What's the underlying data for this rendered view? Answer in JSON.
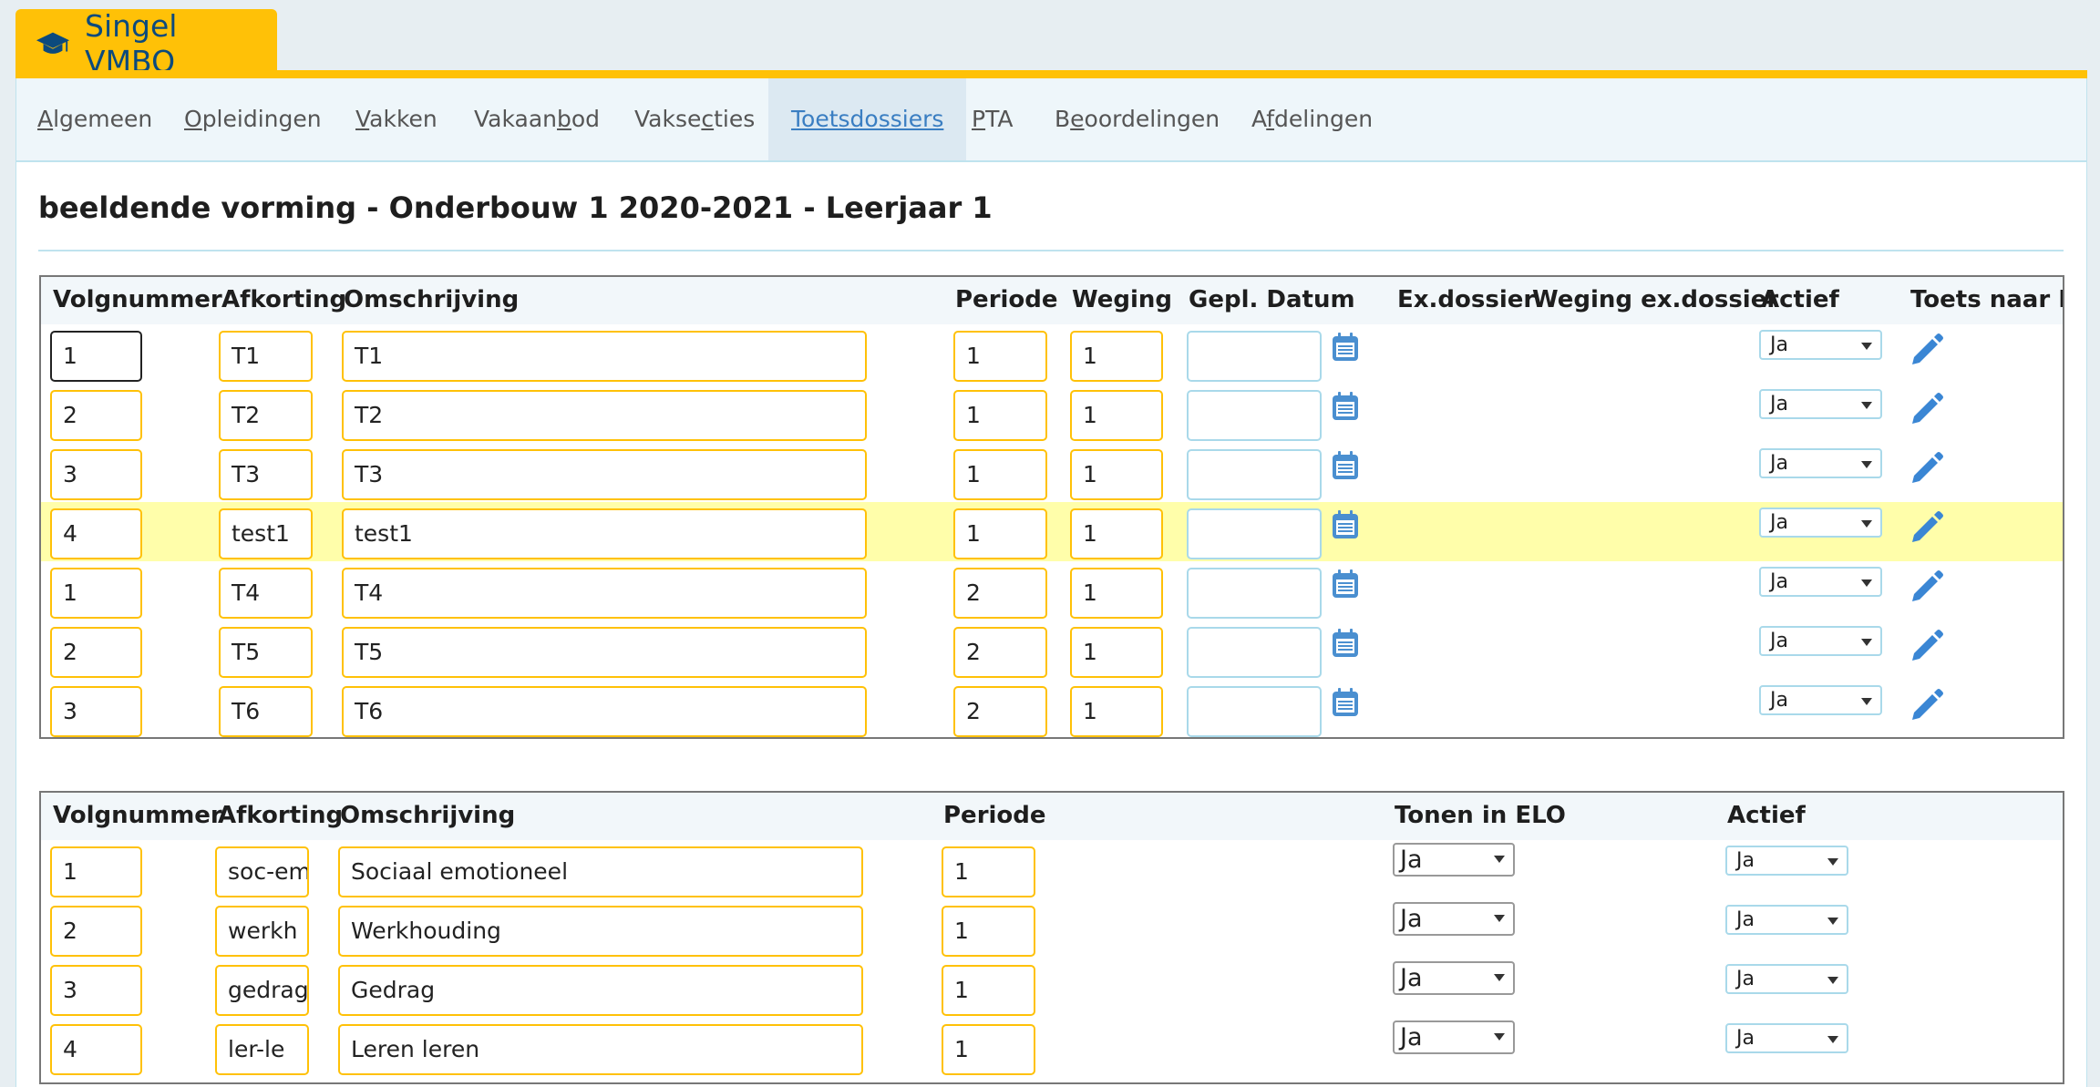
{
  "app": {
    "title": "Singel VMBO",
    "logo_icon": "graduation-cap-icon"
  },
  "colors": {
    "accent": "#ffc107",
    "brand": "#0c4a7d",
    "link_active": "#3a7ec2",
    "highlight_row": "#fffeaa"
  },
  "nav": {
    "items": [
      {
        "pre": "",
        "ul": "A",
        "post": "lgemeen",
        "active": false
      },
      {
        "pre": "",
        "ul": "O",
        "post": "pleidingen",
        "active": false
      },
      {
        "pre": "",
        "ul": "V",
        "post": "akken",
        "active": false
      },
      {
        "pre": "Vakaan",
        "ul": "b",
        "post": "od",
        "active": false
      },
      {
        "pre": "Vakse",
        "ul": "c",
        "post": "ties",
        "active": false
      },
      {
        "pre": "",
        "ul": "T",
        "post": "oetsdossiers",
        "active": true
      },
      {
        "pre": "",
        "ul": "P",
        "post": "TA",
        "active": false
      },
      {
        "pre": "B",
        "ul": "e",
        "post": "oordelingen",
        "active": false
      },
      {
        "pre": "A",
        "ul": "f",
        "post": "delingen",
        "active": false
      }
    ]
  },
  "page": {
    "title": "beeldende vorming - Onderbouw 1 2020-2021 - Leerjaar 1"
  },
  "tests_table": {
    "headers": [
      "Volgnummer",
      "Afkorting",
      "Omschrijving",
      "Periode",
      "Weging",
      "Gepl. Datum",
      "Ex.dossier",
      "Weging ex.dossier",
      "Actief",
      "Toets naar R"
    ],
    "rows": [
      {
        "volgnummer": "1",
        "afkorting": "T1",
        "omschrijving": "T1",
        "periode": "1",
        "weging": "1",
        "datum": "",
        "actief": "Ja"
      },
      {
        "volgnummer": "2",
        "afkorting": "T2",
        "omschrijving": "T2",
        "periode": "1",
        "weging": "1",
        "datum": "",
        "actief": "Ja"
      },
      {
        "volgnummer": "3",
        "afkorting": "T3",
        "omschrijving": "T3",
        "periode": "1",
        "weging": "1",
        "datum": "",
        "actief": "Ja"
      },
      {
        "volgnummer": "4",
        "afkorting": "test1",
        "omschrijving": "test1",
        "periode": "1",
        "weging": "1",
        "datum": "",
        "actief": "Ja"
      },
      {
        "volgnummer": "1",
        "afkorting": "T4",
        "omschrijving": "T4",
        "periode": "2",
        "weging": "1",
        "datum": "",
        "actief": "Ja"
      },
      {
        "volgnummer": "2",
        "afkorting": "T5",
        "omschrijving": "T5",
        "periode": "2",
        "weging": "1",
        "datum": "",
        "actief": "Ja"
      },
      {
        "volgnummer": "3",
        "afkorting": "T6",
        "omschrijving": "T6",
        "periode": "2",
        "weging": "1",
        "datum": "",
        "actief": "Ja"
      }
    ]
  },
  "criteria_table": {
    "headers": [
      "Volgnummer",
      "Afkorting",
      "Omschrijving",
      "Periode",
      "Tonen in ELO",
      "Actief"
    ],
    "rows": [
      {
        "volgnummer": "1",
        "afkorting": "soc-em",
        "omschrijving": "Sociaal emotioneel",
        "periode": "1",
        "tonen_elo": "Ja",
        "actief": "Ja"
      },
      {
        "volgnummer": "2",
        "afkorting": "werkh",
        "omschrijving": "Werkhouding",
        "periode": "1",
        "tonen_elo": "Ja",
        "actief": "Ja"
      },
      {
        "volgnummer": "3",
        "afkorting": "gedrag",
        "omschrijving": "Gedrag",
        "periode": "1",
        "tonen_elo": "Ja",
        "actief": "Ja"
      },
      {
        "volgnummer": "4",
        "afkorting": "ler-le",
        "omschrijving": "Leren leren",
        "periode": "1",
        "tonen_elo": "Ja",
        "actief": "Ja"
      }
    ]
  }
}
